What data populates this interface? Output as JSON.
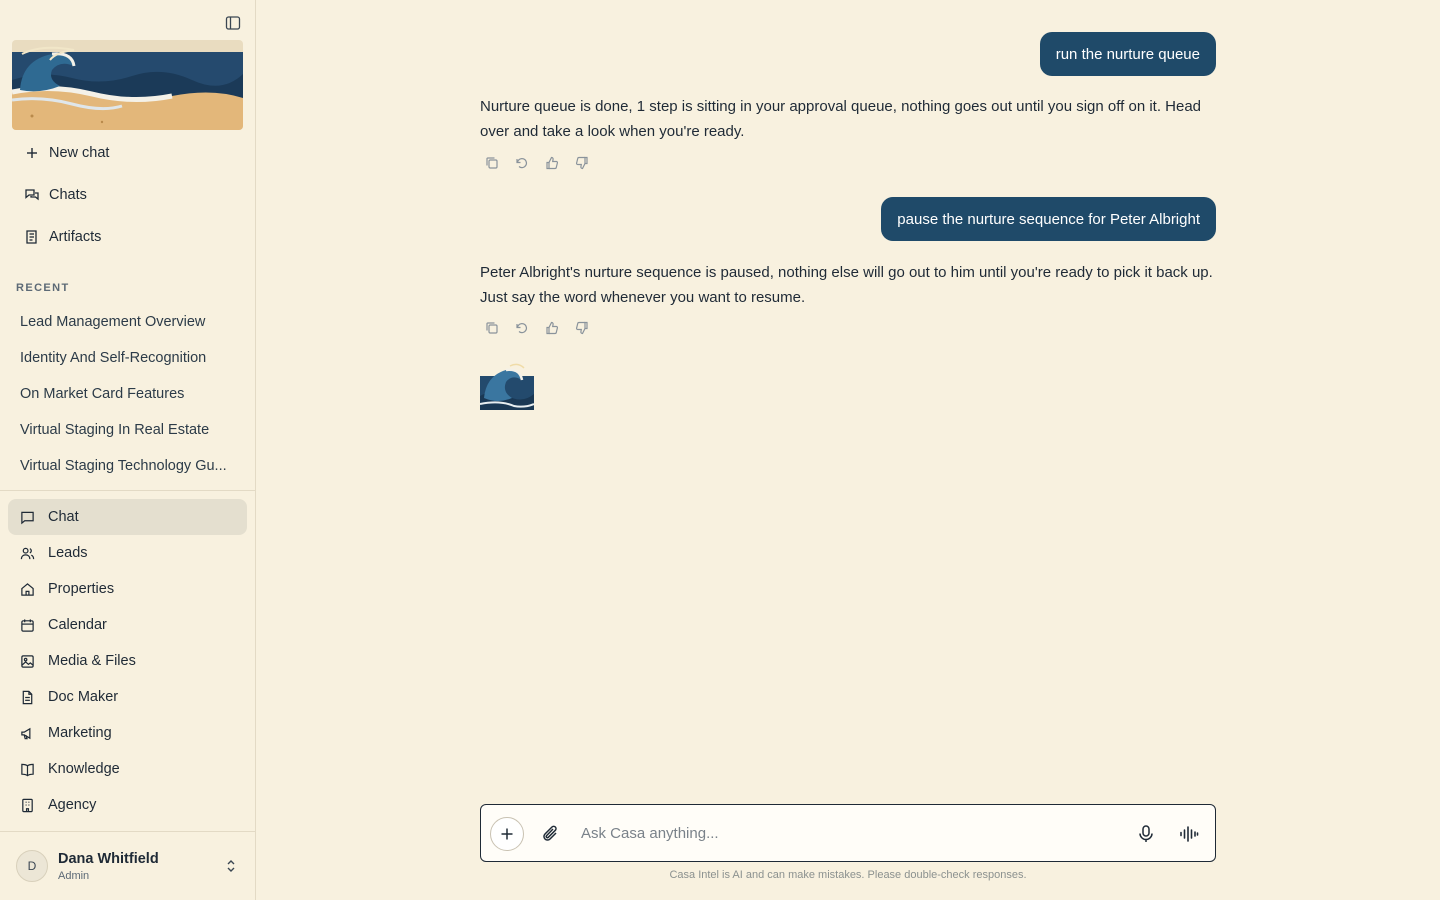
{
  "sidebar": {
    "top_nav": [
      {
        "label": "New chat",
        "icon": "plus-icon"
      },
      {
        "label": "Chats",
        "icon": "chats-icon"
      },
      {
        "label": "Artifacts",
        "icon": "artifacts-icon"
      }
    ],
    "recent_label": "RECENT",
    "recent": [
      "Lead Management Overview",
      "Identity And Self-Recognition",
      "On Market Card Features",
      "Virtual Staging In Real Estate",
      "Virtual Staging Technology Gu..."
    ],
    "main_nav": [
      {
        "label": "Chat",
        "icon": "message-icon",
        "active": true
      },
      {
        "label": "Leads",
        "icon": "users-icon"
      },
      {
        "label": "Properties",
        "icon": "home-icon"
      },
      {
        "label": "Calendar",
        "icon": "calendar-icon"
      },
      {
        "label": "Media & Files",
        "icon": "image-icon"
      },
      {
        "label": "Doc Maker",
        "icon": "document-icon"
      },
      {
        "label": "Marketing",
        "icon": "megaphone-icon"
      },
      {
        "label": "Knowledge",
        "icon": "book-icon"
      },
      {
        "label": "Agency",
        "icon": "building-icon"
      }
    ],
    "user": {
      "initial": "D",
      "name": "Dana Whitfield",
      "role": "Admin"
    }
  },
  "conversation": {
    "messages": [
      {
        "role": "user",
        "text": "run the nurture queue"
      },
      {
        "role": "assistant",
        "text": "Nurture queue is done, 1 step is sitting in your approval queue, nothing goes out until you sign off on it. Head over and take a look when you're ready."
      },
      {
        "role": "user",
        "text": "pause the nurture sequence for Peter Albright"
      },
      {
        "role": "assistant",
        "text": "Peter Albright's nurture sequence is paused, nothing else will go out to him until you're ready to pick it back up. Just say the word whenever you want to resume."
      }
    ]
  },
  "composer": {
    "placeholder": "Ask Casa anything...",
    "disclaimer": "Casa Intel is AI and can make mistakes. Please double-check responses."
  },
  "colors": {
    "background": "#f8f1df",
    "bubble": "#1f4a69",
    "active_nav": "#e4dfcf"
  }
}
